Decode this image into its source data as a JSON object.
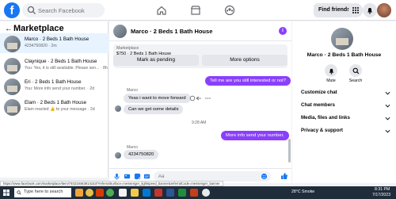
{
  "nav": {
    "search_placeholder": "Search Facebook",
    "find_friends": "Find friends"
  },
  "sidebar": {
    "title": "Marketplace",
    "conversations": [
      {
        "name": "Marco · 2 Beds 1 Bath House",
        "preview": "4234750820 · 2m",
        "active": true
      },
      {
        "name": "Claynique · 2 Beds 1 Bath House",
        "preview": "You: Yes, it is still available. Please sen... · 8h",
        "active": false
      },
      {
        "name": "Eri · 2 Beds 1 Bath House",
        "preview": "You: More info send your number. · 2d",
        "active": false
      },
      {
        "name": "Elam · 2 Beds 1 Bath House",
        "preview": "Elam reacted 👍 to your message · 2d",
        "active": false
      }
    ]
  },
  "chat": {
    "title": "Marco · 2 Beds 1 Bath House",
    "marketplace_label": "Marketplace",
    "listing": "$750 · 2 Beds 1 Bath House",
    "mark_pending": "Mark as pending",
    "more_options": "More options",
    "messages": [
      {
        "dir": "out",
        "text": "Tell me are you still interested or not?"
      },
      {
        "dir": "in",
        "sender": "Marco",
        "text": "Yeas i want to move forward"
      },
      {
        "dir": "in",
        "text": "Can we get some details"
      },
      {
        "dir": "ts",
        "text": "9:28 AM"
      },
      {
        "dir": "out",
        "text": "More info send your number."
      },
      {
        "dir": "in",
        "sender": "Marco",
        "text": "4234750820"
      }
    ],
    "compose_placeholder": "Aa"
  },
  "right": {
    "title": "Marco · 2 Beds 1 Bath House",
    "mute": "Mute",
    "search": "Search",
    "rows": [
      "Customize chat",
      "Chat members",
      "Media, files and links",
      "Privacy & support"
    ]
  },
  "status_url": "https://www.facebook.com/marketplace/item/740218483914153/?referralSurface=messenger_lightspeed_banner&referralCode=messenger_banner",
  "taskbar": {
    "search": "Type here to search",
    "weather": "28°C  Smoke",
    "time": "8:31 PM",
    "date": "7/17/2023"
  },
  "colors": {
    "brand": "#1877f2",
    "accent": "#8a3ffc"
  }
}
